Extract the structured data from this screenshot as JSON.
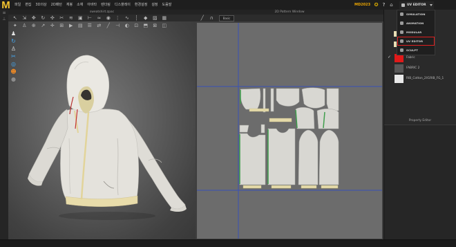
{
  "app": {
    "logo": "M",
    "version": "MD2023"
  },
  "menu": {
    "items": [
      "파일",
      "편집",
      "3D의상",
      "2D패턴",
      "재봉",
      "소재",
      "아바타",
      "렌더링",
      "디스플레이",
      "환경설정",
      "설정",
      "도움말"
    ]
  },
  "top_icons": [
    {
      "name": "settings-icon",
      "color": "#e0b000"
    },
    {
      "name": "help-icon",
      "color": "#e8e8e8"
    },
    {
      "name": "store-icon",
      "color": "#bdbdbd"
    }
  ],
  "mode": {
    "current": "UV EDITOR",
    "options": [
      "SIMULATION",
      "ANIMATION",
      "MODULAR",
      "UV EDITOR",
      "SCULPT"
    ],
    "highlighted": "UV EDITOR",
    "highlight_color": "#e02020"
  },
  "left_strip_icons": [
    "panel-menu-icon",
    "panel-pin-icon"
  ],
  "viewport3d": {
    "title": "sweatshirt.zpac",
    "toolbar_row1": [
      "select-mesh-icon",
      "transform-pattern-icon",
      "pin-icon",
      "fold-icon",
      "tack-icon",
      "cut-icon",
      "steam-icon",
      "strengthen-icon",
      "measure-icon",
      "shirring-icon",
      "button-icon",
      "zipper-icon",
      "puckering-icon",
      "topstitch-icon",
      "trim-icon",
      "graphic-icon",
      "texture-icon"
    ],
    "toolbar_row2": [
      "simulate-icon",
      "avatar-icon",
      "arrangement-icon",
      "select-icon",
      "move-icon",
      "fit-icon",
      "animation-icon",
      "fabric-icon",
      "layer-icon",
      "sewing-icon",
      "line-icon",
      "seam-icon",
      "elastic-icon",
      "boundary-icon",
      "fold-arrange-icon",
      "hanger-icon",
      "display-icon"
    ],
    "side_toolbar": [
      {
        "name": "avatar-pose-icon",
        "color": "#e6e6e6"
      },
      {
        "name": "rotate-view-icon",
        "color": "#46a8f0"
      },
      {
        "name": "avatar-view-icon",
        "color": "#e6e6e6"
      },
      {
        "name": "scissors-icon",
        "color": "#46a8f0"
      },
      {
        "name": "measure-tape-icon",
        "color": "#46a8f0"
      },
      {
        "name": "avatar-orange-icon",
        "color": "#f08a24"
      },
      {
        "name": "view-dot-icon",
        "color": "#8c8c8c"
      }
    ]
  },
  "pattern2d": {
    "title": "2D Pattern Window",
    "toolbar": [
      "transform-2d-icon",
      "edit-curve-icon"
    ],
    "view_mode": "Basic"
  },
  "object_browser": {
    "upper_swatches": [
      "#e9dfb5",
      "#e9dfb5"
    ],
    "materials": [
      {
        "name": "Fabric",
        "color": "#e01919"
      },
      {
        "name": "FABRIC 2",
        "color": "#575757"
      },
      {
        "name": "RIB_Cotton_2X1RIB_FG_1",
        "color": "#e9e9e9"
      }
    ]
  },
  "property_editor": {
    "title": "Property Editor"
  },
  "colors": {
    "accent": "#f4c430",
    "guide_line": "#3950b8",
    "fabric": "#e4e2dc",
    "trim": "#e4d9a8",
    "seam_line": "#3f9e4c"
  }
}
